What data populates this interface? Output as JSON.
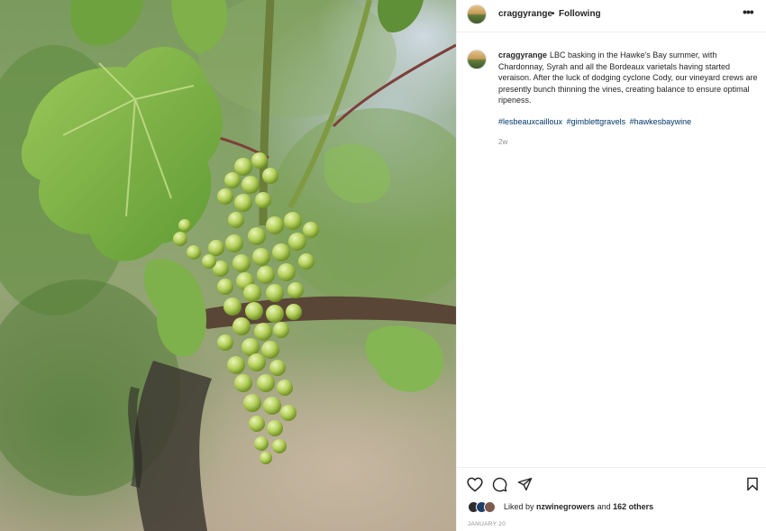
{
  "post": {
    "username": "craggyrange",
    "separator": "•",
    "follow_status": "Following",
    "more_label": "•••",
    "caption_user": "craggyrange",
    "caption_text": "LBC basking in the Hawke's Bay summer, with Chardonnay, Syrah and all the Bordeaux varietals having started veraison. After the luck of dodging cyclone Cody, our vineyard crews are presently bunch thinning the vines, creating balance to ensure optimal ripeness.",
    "hashtags": [
      "#lesbeauxcailloux",
      "#gimblettgravels",
      "#hawkesbaywine"
    ],
    "time_ago": "2w",
    "likes_prefix": "Liked by",
    "likes_user": "nzwinegrowers",
    "likes_and": "and",
    "likes_others": "162 others",
    "date": "JANUARY 20"
  },
  "icons": {
    "like": "heart-icon",
    "comment": "comment-icon",
    "share": "paper-plane-icon",
    "save": "bookmark-icon"
  },
  "colors": {
    "hashtag": "#00376b",
    "text": "#262626",
    "muted": "#8e8e8e"
  }
}
